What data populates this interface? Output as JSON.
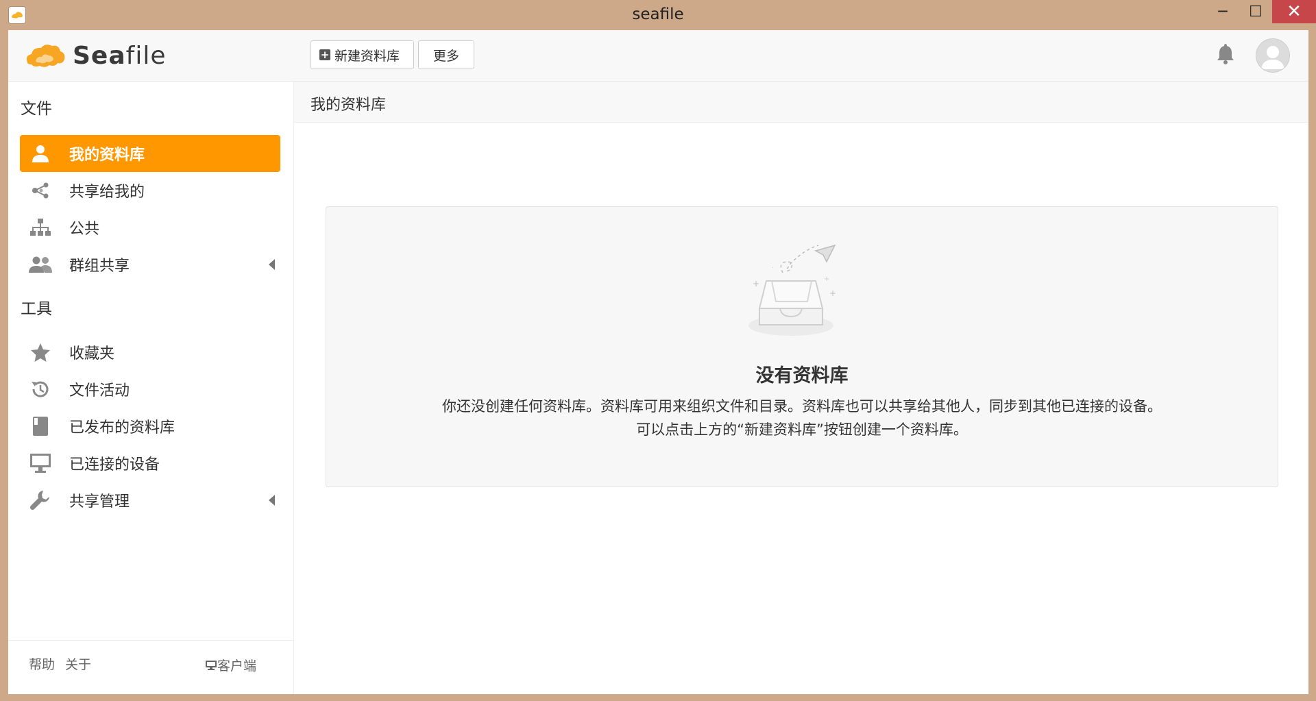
{
  "window": {
    "title": "seafile",
    "minimize": "─",
    "maximize": "☐",
    "close": "✕"
  },
  "header": {
    "logo_text_a": "Sea",
    "logo_text_b": "file",
    "new_library_label": "新建资料库",
    "more_label": "更多"
  },
  "sidebar": {
    "files_heading": "文件",
    "items": [
      {
        "label": "我的资料库",
        "icon": "user-icon"
      },
      {
        "label": "共享给我的",
        "icon": "share-icon"
      },
      {
        "label": "公共",
        "icon": "org-chart-icon"
      },
      {
        "label": "群组共享",
        "icon": "group-icon"
      }
    ],
    "tools_heading": "工具",
    "tools": [
      {
        "label": "收藏夹",
        "icon": "star-icon"
      },
      {
        "label": "文件活动",
        "icon": "history-icon"
      },
      {
        "label": "已发布的资料库",
        "icon": "book-icon"
      },
      {
        "label": "已连接的设备",
        "icon": "monitor-icon"
      },
      {
        "label": "共享管理",
        "icon": "wrench-icon"
      }
    ],
    "footer": {
      "help": "帮助",
      "about": "关于",
      "client": "客户端"
    }
  },
  "main": {
    "path_title": "我的资料库",
    "empty_title": "没有资料库",
    "empty_desc_line1": "你还没创建任何资料库。资料库可用来组织文件和目录。资料库也可以共享给其他人，同步到其他已连接的设备。",
    "empty_desc_line2": "可以点击上方的“新建资料库”按钮创建一个资料库。"
  },
  "colors": {
    "accent": "#ff9800",
    "chrome": "#cda98a",
    "close": "#c7464a"
  }
}
